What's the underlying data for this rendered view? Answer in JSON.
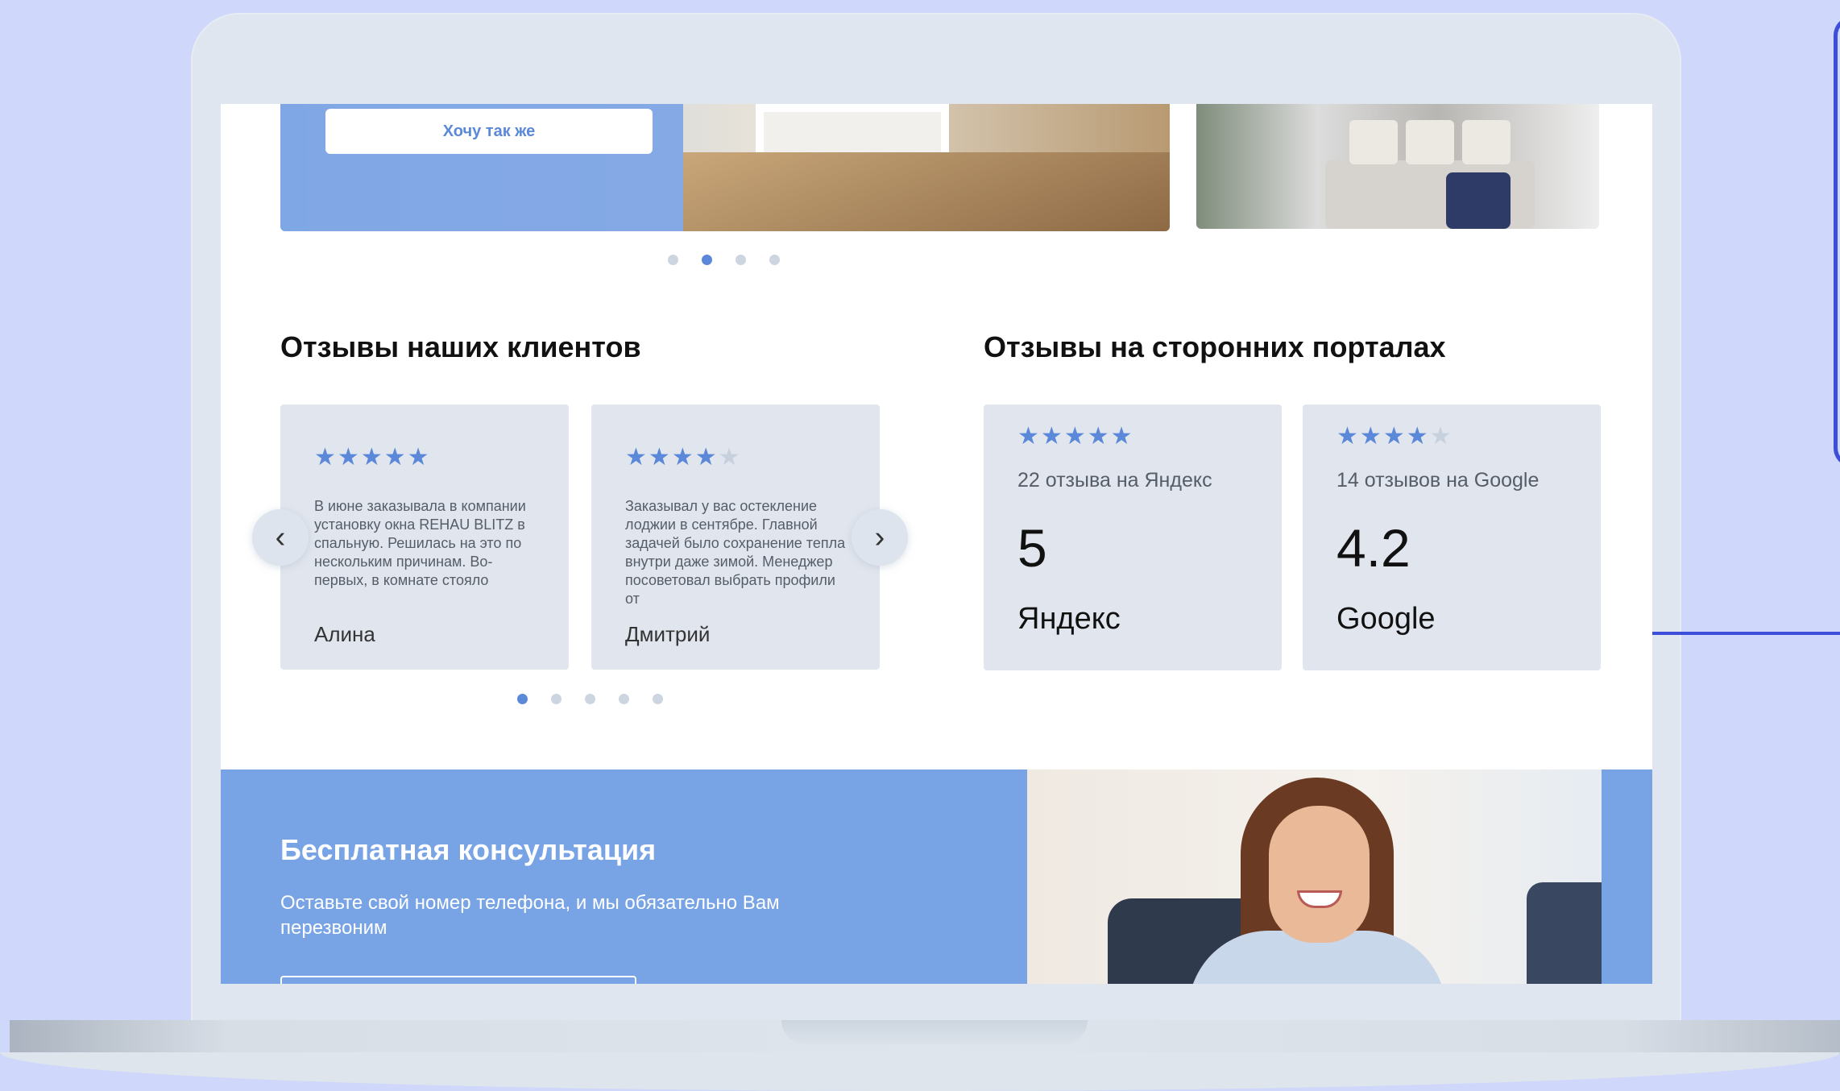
{
  "slider": {
    "cta_label": "Хочу так же"
  },
  "reviews": {
    "title": "Отзывы наших клиентов",
    "items": [
      {
        "rating": 5,
        "text": "В июне заказывала в компании установку окна REHAU BLITZ в спальную. Решилась на это по нескольким причинам. Во-первых, в комнате стояло",
        "author": "Алина"
      },
      {
        "rating": 4,
        "text": "Заказывал у вас остекление лоджии в сентябре. Главной задачей было сохранение тепла внутри даже зимой. Менеджер посоветовал выбрать профили от",
        "author": "Дмитрий"
      }
    ],
    "prev_icon": "chevron-left-icon",
    "next_icon": "chevron-right-icon"
  },
  "portals": {
    "title": "Отзывы на сторонних порталах",
    "items": [
      {
        "stars": 5,
        "count_text": "22 отзыва на Яндекс",
        "rating": "5",
        "name": "Яндекс"
      },
      {
        "stars": 4,
        "count_text": "14 отзывов на Google",
        "rating": "4.2",
        "name": "Google"
      }
    ]
  },
  "consultation": {
    "title": "Бесплатная консультация",
    "text": "Оставьте свой номер телефона, и мы обязательно Вам перезвоним"
  },
  "colors": {
    "accent": "#5b88d8",
    "banner": "#78a4e6",
    "card": "#e1e6ee",
    "annotation": "#3d4ed9",
    "background": "#cfd7fb"
  }
}
